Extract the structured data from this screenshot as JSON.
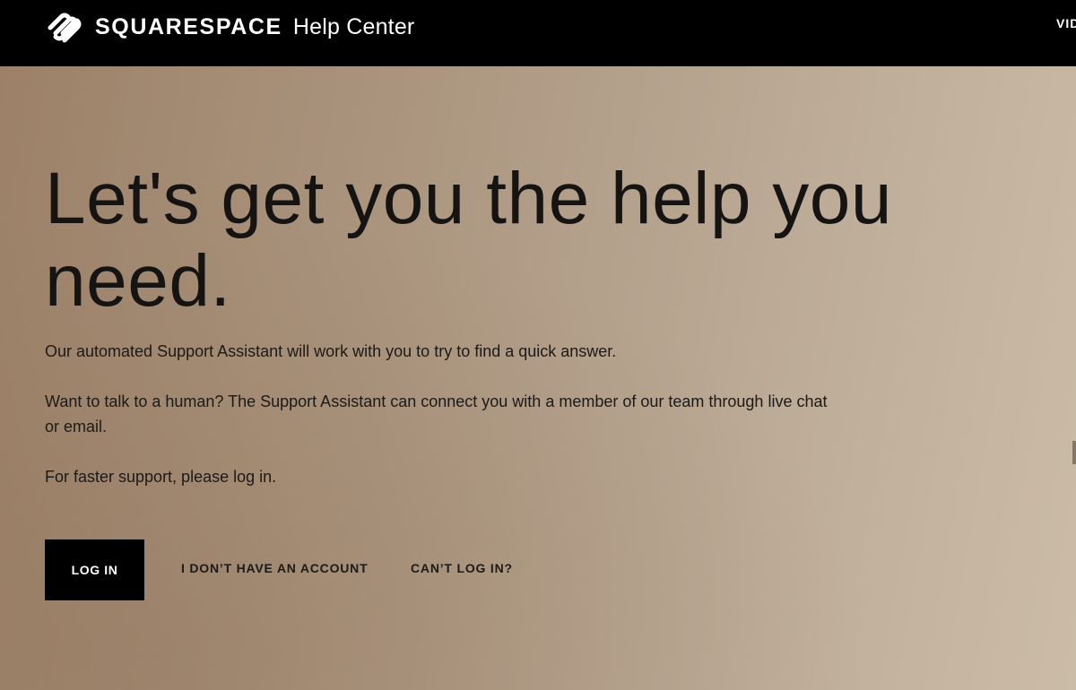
{
  "header": {
    "brand_name": "SQUARESPACE",
    "brand_sub": "Help Center",
    "logo_icon": "squarespace-logo-icon",
    "nav_cut_label": "VID"
  },
  "hero": {
    "headline": "Let's get you the help you need.",
    "paragraph_1": "Our automated Support Assistant will work with you to try to find a quick answer.",
    "paragraph_2": "Want to talk to a human? The Support Assistant can connect you with a member of our team through live chat or email.",
    "paragraph_3": "For faster support, please log in."
  },
  "actions": {
    "login_label": "LOG IN",
    "no_account_label": "I DON’T HAVE AN ACCOUNT",
    "cant_login_label": "CAN’T LOG IN?"
  },
  "colors": {
    "topbar": "#000000",
    "hero_bg_start": "#9c8168",
    "hero_bg_end": "#cbbca8",
    "text_dark": "#161412",
    "button_bg": "#000000",
    "button_text": "#ffffff"
  }
}
